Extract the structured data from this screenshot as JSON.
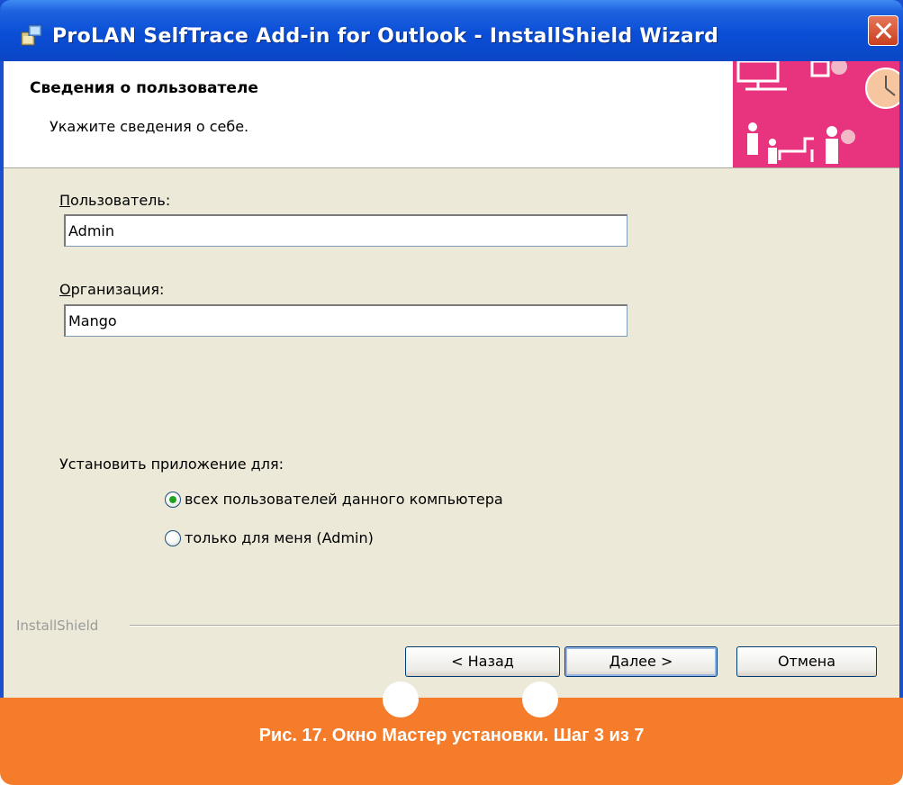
{
  "window": {
    "title": "ProLAN SelfTrace Add-in for Outlook - InstallShield Wizard"
  },
  "banner": {
    "title": "Сведения о пользователе",
    "subtitle": "Укажите сведения о себе."
  },
  "form": {
    "user_label_accel": "П",
    "user_label_rest": "ользователь:",
    "user_value": "Admin",
    "org_label_accel": "О",
    "org_label_rest": "рганизация:",
    "org_value": "Mango",
    "install_for_label": "Установить приложение для:",
    "options": [
      {
        "label": "всех пользователей данного компьютера",
        "selected": true
      },
      {
        "label": "только для меня (Admin)",
        "selected": false
      }
    ]
  },
  "footer_brand": "InstallShield",
  "buttons": {
    "back": "< Назад",
    "next": "Далее >",
    "cancel": "Отмена"
  },
  "caption": "Рис. 17. Окно Мастер установки. Шаг 3 из 7",
  "colors": {
    "titlebar": "#0a4ed6",
    "dialog_bg": "#ece9d8",
    "banner_accent": "#e8347e",
    "caption_bar": "#f47c2a"
  }
}
